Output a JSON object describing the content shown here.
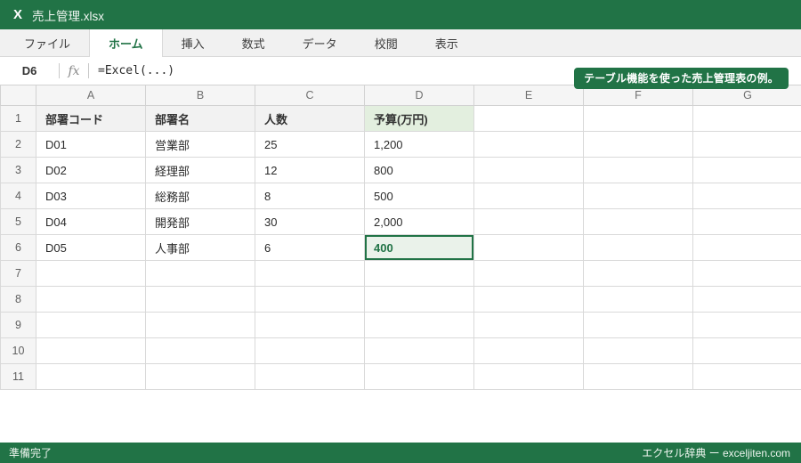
{
  "window": {
    "app_icon": "X",
    "title": "売上管理.xlsx"
  },
  "menu": {
    "tabs": [
      {
        "id": "file",
        "label": "ファイル",
        "active": false
      },
      {
        "id": "home",
        "label": "ホーム",
        "active": true
      },
      {
        "id": "insert",
        "label": "挿入",
        "active": false
      },
      {
        "id": "formulas",
        "label": "数式",
        "active": false
      },
      {
        "id": "data",
        "label": "データ",
        "active": false
      },
      {
        "id": "review",
        "label": "校閲",
        "active": false
      },
      {
        "id": "view",
        "label": "表示",
        "active": false
      }
    ]
  },
  "formula_bar": {
    "name_box": "D6",
    "fx_label": "fx",
    "formula": "=Excel(...)"
  },
  "callout": {
    "text": "テーブル機能を使った売上管理表の例。"
  },
  "grid": {
    "column_letters": [
      "A",
      "B",
      "C",
      "D",
      "E",
      "F",
      "G"
    ],
    "row_count": 11,
    "header_row": {
      "cells": [
        "部署コード",
        "部署名",
        "人数",
        "予算(万円)"
      ],
      "highlight_column": "D"
    },
    "data_rows": [
      [
        "D01",
        "営業部",
        "25",
        "1,200"
      ],
      [
        "D02",
        "経理部",
        "12",
        "800"
      ],
      [
        "D03",
        "総務部",
        "8",
        "500"
      ],
      [
        "D04",
        "開発部",
        "30",
        "2,000"
      ],
      [
        "D05",
        "人事部",
        "6",
        "400"
      ]
    ],
    "selected_cell": {
      "ref": "D6",
      "value": "400"
    }
  },
  "status_bar": {
    "left": "準備完了",
    "right": "エクセル辞典 ー exceljiten.com"
  },
  "colors": {
    "brand_green": "#217346",
    "header_fill": "#f2f2f2",
    "budget_header_fill": "#e3efdf",
    "selected_fill": "#eaf2ea",
    "gridline": "#d9d9d9"
  }
}
